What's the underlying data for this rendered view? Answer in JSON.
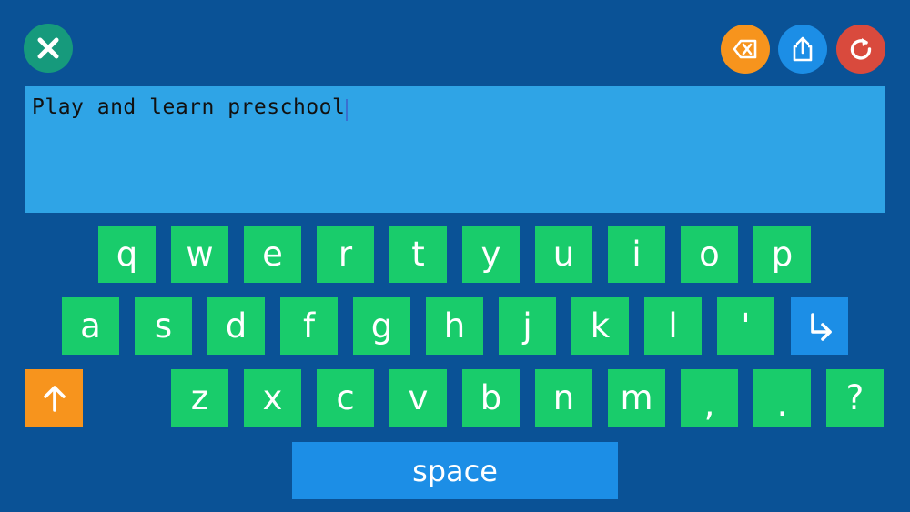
{
  "toolbar": {
    "close_icon": "close-icon",
    "backspace_icon": "backspace-icon",
    "share_icon": "share-icon",
    "reset_icon": "reset-icon",
    "colors": {
      "close": "#169a7c",
      "backspace": "#f7941d",
      "share": "#1c8ee6",
      "reset": "#d94a3d"
    }
  },
  "text_field": {
    "value": "Play and learn preschool"
  },
  "keyboard": {
    "row1": [
      "q",
      "w",
      "e",
      "r",
      "t",
      "y",
      "u",
      "i",
      "o",
      "p"
    ],
    "row2": [
      "a",
      "s",
      "d",
      "f",
      "g",
      "h",
      "j",
      "k",
      "l",
      "'"
    ],
    "row3": [
      "z",
      "x",
      "c",
      "v",
      "b",
      "n",
      "m",
      ",",
      ".",
      "?"
    ],
    "enter_icon": "return-arrow-icon",
    "shift_icon": "shift-arrow-icon",
    "space_label": "space",
    "colors": {
      "letter_key": "#19cc6b",
      "special_key": "#1c8ee6",
      "shift_key": "#f7941d",
      "background": "#0a5296"
    }
  }
}
